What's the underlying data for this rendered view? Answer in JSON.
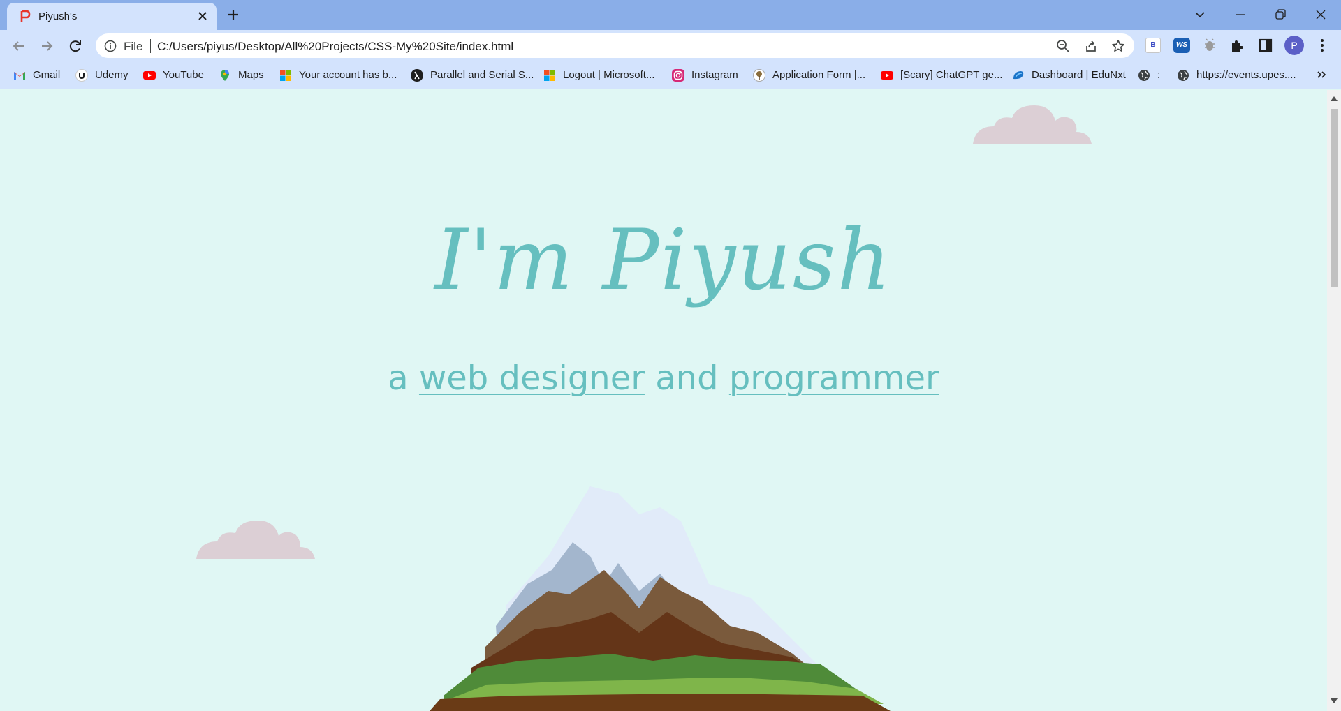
{
  "browser": {
    "tab": {
      "title": "Piyush's"
    },
    "omnibox": {
      "scheme_label": "File",
      "url": "C:/Users/piyus/Desktop/All%20Projects/CSS-My%20Site/index.html"
    },
    "extensions": {
      "b_label": "B",
      "ws_label": "WS"
    },
    "profile_initial": "P"
  },
  "bookmarks": [
    {
      "label": "Gmail",
      "icon": "gmail-icon"
    },
    {
      "label": "Udemy",
      "icon": "udemy-icon"
    },
    {
      "label": "YouTube",
      "icon": "youtube-icon"
    },
    {
      "label": "Maps",
      "icon": "maps-icon"
    },
    {
      "label": "Your account has b...",
      "icon": "microsoft-icon"
    },
    {
      "label": "Parallel and Serial S...",
      "icon": "lambda-icon"
    },
    {
      "label": "Logout | Microsoft...",
      "icon": "microsoft-icon"
    },
    {
      "label": "Instagram",
      "icon": "instagram-icon"
    },
    {
      "label": "Application Form |...",
      "icon": "tree-icon"
    },
    {
      "label": "[Scary] ChatGPT ge...",
      "icon": "youtube-icon"
    },
    {
      "label": "Dashboard | EduNxt",
      "icon": "edunxt-icon"
    },
    {
      "label": ":",
      "icon": "globe-icon"
    },
    {
      "label": "https://events.upes....",
      "icon": "globe-icon"
    }
  ],
  "page": {
    "title": "I'm Piyush",
    "subtitle": {
      "prefix": "a",
      "link1": "web designer",
      "middle": "and",
      "link2": "programmer"
    }
  },
  "colors": {
    "page_background": "#e0f7f4",
    "accent": "#66bfbf",
    "cloud": "#dccfd5"
  }
}
